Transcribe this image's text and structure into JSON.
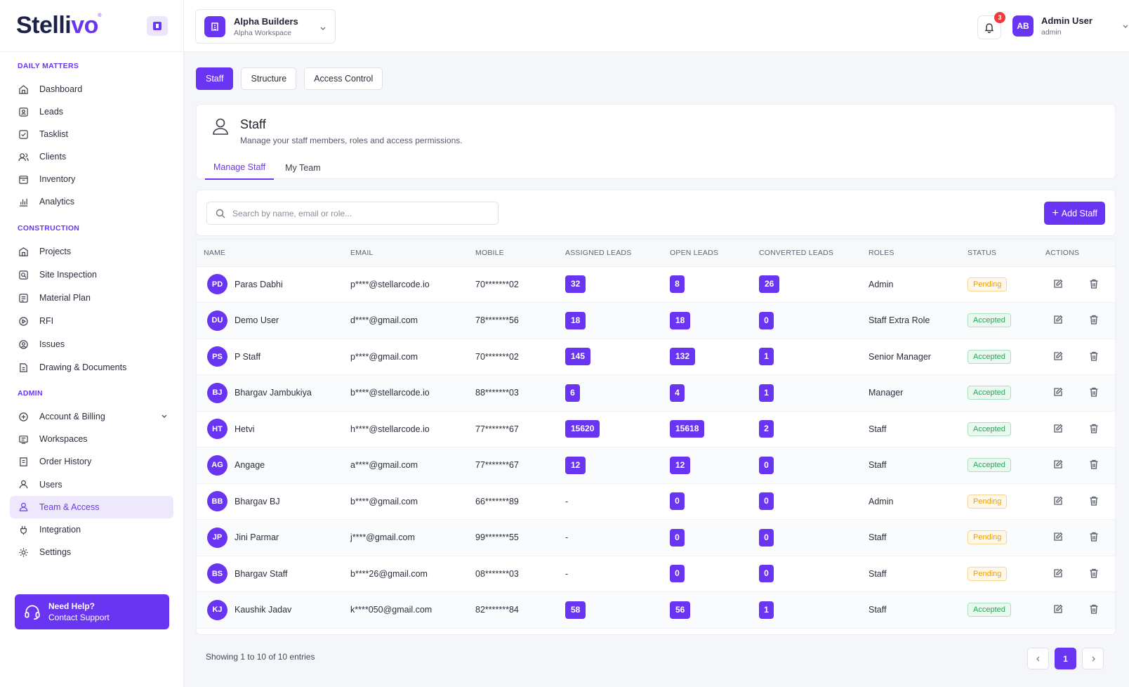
{
  "brand": {
    "name_main": "Stelli",
    "name_accent": "vo",
    "mark": "®"
  },
  "sidebar": {
    "sections": [
      {
        "title": "DAILY MATTERS",
        "items": [
          {
            "label": "Dashboard",
            "icon": "dashboard-icon"
          },
          {
            "label": "Leads",
            "icon": "leads-icon"
          },
          {
            "label": "Tasklist",
            "icon": "tasklist-icon"
          },
          {
            "label": "Clients",
            "icon": "clients-icon"
          },
          {
            "label": "Inventory",
            "icon": "inventory-icon"
          },
          {
            "label": "Analytics",
            "icon": "analytics-icon"
          }
        ]
      },
      {
        "title": "CONSTRUCTION",
        "items": [
          {
            "label": "Projects",
            "icon": "projects-icon"
          },
          {
            "label": "Site Inspection",
            "icon": "site-inspection-icon"
          },
          {
            "label": "Material Plan",
            "icon": "material-plan-icon"
          },
          {
            "label": "RFI",
            "icon": "rfi-icon"
          },
          {
            "label": "Issues",
            "icon": "issues-icon"
          },
          {
            "label": "Drawing & Documents",
            "icon": "documents-icon"
          }
        ]
      },
      {
        "title": "ADMIN",
        "items": [
          {
            "label": "Account & Billing",
            "icon": "billing-icon"
          },
          {
            "label": "Workspaces",
            "icon": "workspaces-icon"
          },
          {
            "label": "Order History",
            "icon": "order-history-icon"
          },
          {
            "label": "Users",
            "icon": "users-icon"
          },
          {
            "label": "Team & Access",
            "icon": "team-icon"
          },
          {
            "label": "Integration",
            "icon": "integration-icon"
          },
          {
            "label": "Settings",
            "icon": "settings-icon"
          }
        ]
      }
    ],
    "help": {
      "title": "Need Help?",
      "subtitle": "Contact Support"
    }
  },
  "topbar": {
    "workspace": {
      "name": "Alpha Builders",
      "sub": "Alpha Workspace"
    },
    "notifications": "3",
    "user": {
      "initials": "AB",
      "name": "Admin User",
      "role": "admin"
    }
  },
  "tabs": [
    "Staff",
    "Structure",
    "Access Control"
  ],
  "header": {
    "title": "Staff",
    "subtitle": "Manage your staff members, roles and access permissions.",
    "subtabs": [
      "Manage Staff",
      "My Team"
    ]
  },
  "search": {
    "placeholder": "Search by name, email or role..."
  },
  "add_button": "Add Staff",
  "table": {
    "columns": [
      "NAME",
      "EMAIL",
      "MOBILE",
      "ASSIGNED LEADS",
      "OPEN LEADS",
      "CONVERTED LEADS",
      "ROLES",
      "STATUS",
      "ACTIONS"
    ],
    "rows": [
      {
        "initials": "PD",
        "name": "Paras Dabhi",
        "email": "p****@stellarcode.io",
        "mobile": "70*******02",
        "assigned": "32",
        "open": "8",
        "converted": "26",
        "role": "Admin",
        "status": "Pending"
      },
      {
        "initials": "DU",
        "name": "Demo User",
        "email": "d****@gmail.com",
        "mobile": "78*******56",
        "assigned": "18",
        "open": "18",
        "converted": "0",
        "role": "Staff Extra Role",
        "status": "Accepted"
      },
      {
        "initials": "PS",
        "name": "P Staff",
        "email": "p****@gmail.com",
        "mobile": "70*******02",
        "assigned": "145",
        "open": "132",
        "converted": "1",
        "role": "Senior Manager",
        "status": "Accepted"
      },
      {
        "initials": "BJ",
        "name": "Bhargav Jambukiya",
        "email": "b****@stellarcode.io",
        "mobile": "88*******03",
        "assigned": "6",
        "open": "4",
        "converted": "1",
        "role": "Manager",
        "status": "Accepted"
      },
      {
        "initials": "HT",
        "name": "Hetvi",
        "email": "h****@stellarcode.io",
        "mobile": "77*******67",
        "assigned": "15620",
        "open": "15618",
        "converted": "2",
        "role": "Staff",
        "status": "Accepted"
      },
      {
        "initials": "AG",
        "name": "Angage",
        "email": "a****@gmail.com",
        "mobile": "77*******67",
        "assigned": "12",
        "open": "12",
        "converted": "0",
        "role": "Staff",
        "status": "Accepted"
      },
      {
        "initials": "BB",
        "name": "Bhargav BJ",
        "email": "b****@gmail.com",
        "mobile": "66*******89",
        "assigned": "-",
        "open": "0",
        "converted": "0",
        "role": "Admin",
        "status": "Pending"
      },
      {
        "initials": "JP",
        "name": "Jini Parmar",
        "email": "j****@gmail.com",
        "mobile": "99*******55",
        "assigned": "-",
        "open": "0",
        "converted": "0",
        "role": "Staff",
        "status": "Pending"
      },
      {
        "initials": "BS",
        "name": "Bhargav Staff",
        "email": "b****26@gmail.com",
        "mobile": "08*******03",
        "assigned": "-",
        "open": "0",
        "converted": "0",
        "role": "Staff",
        "status": "Pending"
      },
      {
        "initials": "KJ",
        "name": "Kaushik Jadav",
        "email": "k****050@gmail.com",
        "mobile": "82*******84",
        "assigned": "58",
        "open": "56",
        "converted": "1",
        "role": "Staff",
        "status": "Accepted"
      }
    ]
  },
  "footer": {
    "showing": "Showing 1 to 10 of 10 entries",
    "page": "1"
  },
  "colors": {
    "accent": "#6a35f2",
    "pending": "#e99f12",
    "accepted": "#27a65a"
  }
}
